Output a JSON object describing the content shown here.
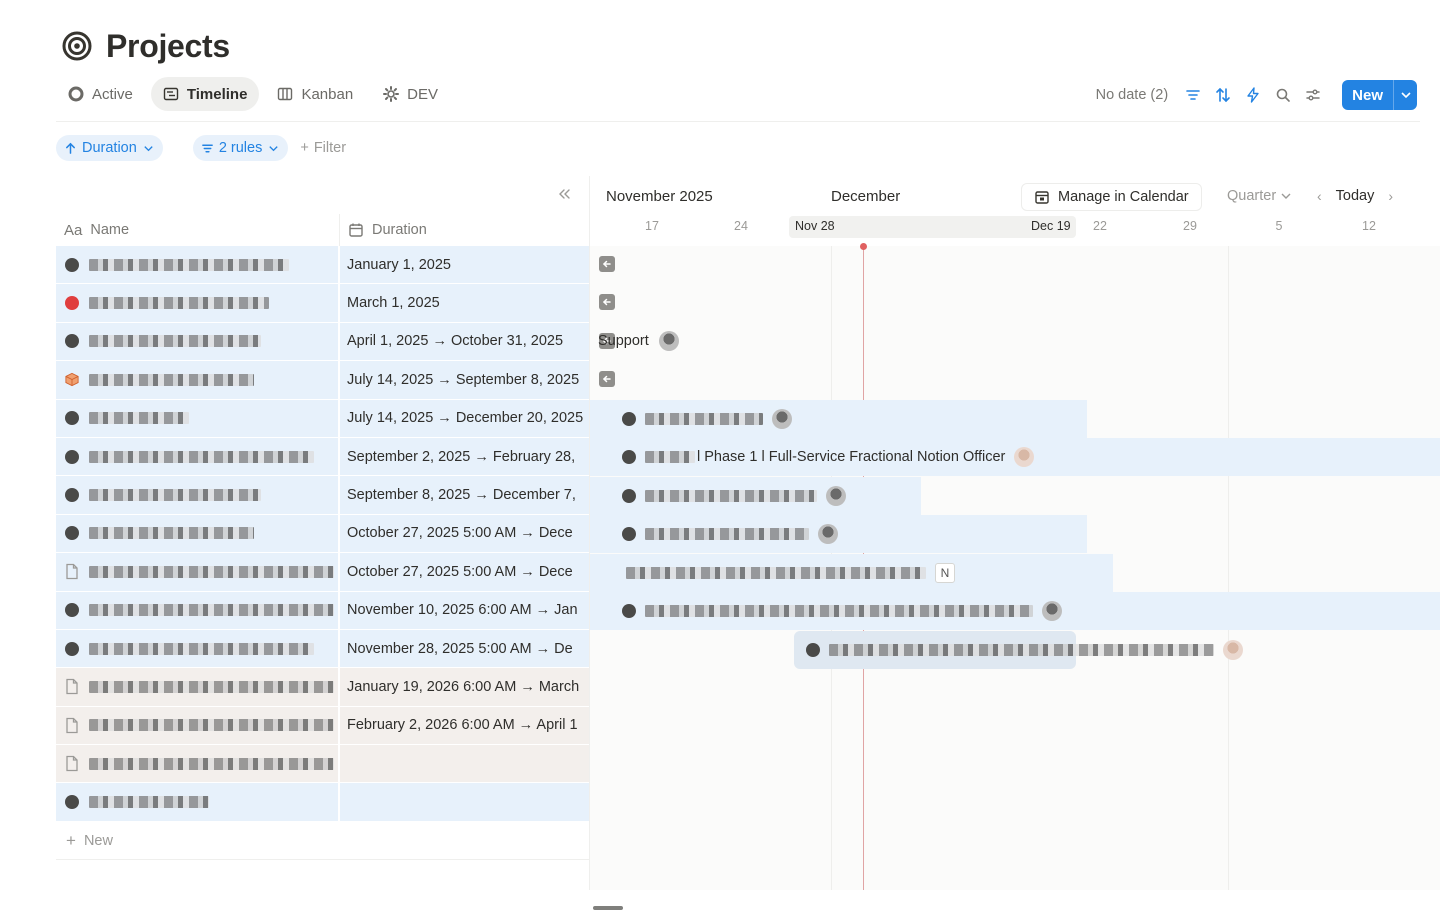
{
  "page": {
    "title": "Projects",
    "title_icon": "target-icon"
  },
  "views": [
    {
      "label": "Active",
      "icon": "circle-icon",
      "active": false
    },
    {
      "label": "Timeline",
      "icon": "timeline-icon",
      "active": true
    },
    {
      "label": "Kanban",
      "icon": "board-icon",
      "active": false
    },
    {
      "label": "DEV",
      "icon": "gear-icon",
      "active": false
    }
  ],
  "toolbar": {
    "no_date": "No date (2)",
    "new_label": "New"
  },
  "filters": {
    "sort_label": "Duration",
    "rules_label": "2 rules",
    "add_filter": "Filter"
  },
  "table": {
    "name_header": "Name",
    "name_header_icon": "Aa",
    "duration_header": "Duration",
    "new_row": "New",
    "rows": [
      {
        "status": "dark",
        "color": "blue",
        "duration": "January 1, 2025"
      },
      {
        "status": "red",
        "color": "blue",
        "duration": "March 1, 2025"
      },
      {
        "status": "dark",
        "color": "blue",
        "duration": "April 1, 2025 → October 31, 2025"
      },
      {
        "status": "box",
        "color": "blue",
        "duration": "July 14, 2025 → September 8, 2025"
      },
      {
        "status": "dark",
        "color": "blue",
        "duration": "July 14, 2025 → December 20, 2025"
      },
      {
        "status": "dark",
        "color": "blue",
        "duration": "September 2, 2025 → February 28,"
      },
      {
        "status": "dark",
        "color": "blue",
        "duration": "September 8, 2025 → December 7,"
      },
      {
        "status": "dark",
        "color": "blue",
        "duration": "October 27, 2025 5:00 AM → Dece"
      },
      {
        "status": "page",
        "color": "blue",
        "duration": "October 27, 2025 5:00 AM → Dece"
      },
      {
        "status": "dark",
        "color": "blue",
        "duration": "November 10, 2025 6:00 AM → Jan"
      },
      {
        "status": "dark",
        "color": "blue",
        "duration": "November 28, 2025 5:00 AM → De"
      },
      {
        "status": "page",
        "color": "beige",
        "duration": "January 19, 2026 6:00 AM → March"
      },
      {
        "status": "page",
        "color": "beige",
        "duration": "February 2, 2026 6:00 AM → April 1"
      },
      {
        "status": "page",
        "color": "beige",
        "duration": ""
      },
      {
        "status": "dark",
        "color": "blue",
        "duration": ""
      }
    ]
  },
  "timeline": {
    "months": [
      "November 2025",
      "December"
    ],
    "ticks": [
      "17",
      "24",
      "22",
      "29",
      "5",
      "12"
    ],
    "range_start": "Nov 28",
    "range_end": "Dec 19",
    "manage_calendar": "Manage in Calendar",
    "zoom": "Quarter",
    "today": "Today",
    "bar_support": "Support",
    "bar_phase": "l Phase 1 l Full-Service Fractional Notion Officer",
    "n_badge": "N"
  }
}
